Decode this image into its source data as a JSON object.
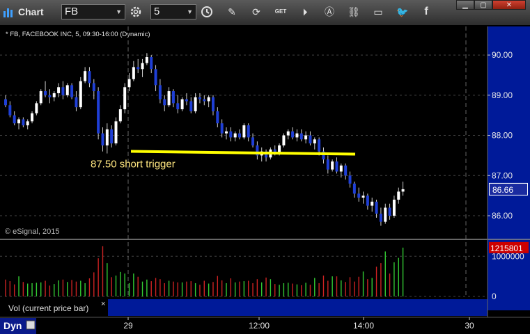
{
  "toolbar": {
    "app_title": "Chart",
    "symbol": "FB",
    "interval": "5",
    "buttons": [
      "pencil-icon",
      "refresh-icon",
      "get-icon",
      "play-icon",
      "alert-icon",
      "link-icon",
      "comment-icon",
      "twitter-icon",
      "facebook-icon"
    ],
    "window_buttons": [
      "minimize",
      "maximize",
      "close"
    ]
  },
  "chart_header": "* FB, FACEBOOK INC, 5, 09:30-16:00 (Dynamic)",
  "copyright": "© eSignal, 2015",
  "volume_label": "Vol (current price bar)",
  "volume_close": "×",
  "bottom": {
    "dyn": "Dyn"
  },
  "colors": {
    "up": "#ffffff",
    "down": "#1f3fd6",
    "panel": "#001a99",
    "price_badge": "#1a2ba0",
    "vol_badge": "#cc0000",
    "annotation": "#ffff00",
    "vol_up": "#33cc33",
    "vol_down": "#cc2222"
  },
  "chart_data": {
    "type": "candlestick",
    "y_ticks": [
      "90.00",
      "89.00",
      "88.00",
      "87.00",
      "86.00"
    ],
    "ylim": [
      85.55,
      90.4
    ],
    "x_ticks": [
      "29",
      "12:00",
      "14:00",
      "30"
    ],
    "last_price": "86.66",
    "last_volume": "1215801",
    "volume_ticks": [
      "1000000",
      "0"
    ],
    "volume_max": 1300000,
    "annotation": {
      "text": "87.50 short trigger",
      "price": 87.55
    },
    "candles": [
      [
        88.9,
        89.0,
        88.7,
        88.75
      ],
      [
        88.75,
        88.85,
        88.45,
        88.5
      ],
      [
        88.5,
        88.6,
        88.25,
        88.3
      ],
      [
        88.3,
        88.45,
        88.15,
        88.4
      ],
      [
        88.4,
        88.45,
        88.2,
        88.25
      ],
      [
        88.25,
        88.4,
        88.15,
        88.35
      ],
      [
        88.35,
        88.6,
        88.3,
        88.55
      ],
      [
        88.55,
        88.85,
        88.5,
        88.8
      ],
      [
        88.8,
        89.15,
        88.75,
        89.1
      ],
      [
        89.1,
        89.35,
        88.95,
        89.0
      ],
      [
        89.0,
        89.15,
        88.8,
        88.95
      ],
      [
        88.95,
        89.1,
        88.85,
        89.05
      ],
      [
        89.05,
        89.3,
        88.95,
        89.2
      ],
      [
        89.2,
        89.35,
        88.9,
        89.0
      ],
      [
        89.0,
        89.3,
        88.95,
        89.25
      ],
      [
        89.25,
        89.3,
        88.9,
        88.95
      ],
      [
        88.95,
        89.1,
        88.6,
        88.7
      ],
      [
        88.7,
        89.45,
        88.65,
        89.35
      ],
      [
        89.35,
        89.7,
        89.3,
        89.6
      ],
      [
        89.6,
        89.7,
        89.2,
        89.3
      ],
      [
        89.3,
        89.4,
        88.9,
        89.1
      ],
      [
        89.1,
        89.2,
        87.9,
        88.05
      ],
      [
        88.05,
        88.2,
        87.6,
        87.75
      ],
      [
        87.75,
        88.3,
        87.55,
        88.15
      ],
      [
        88.15,
        88.25,
        87.7,
        87.8
      ],
      [
        87.8,
        88.45,
        87.75,
        88.35
      ],
      [
        88.35,
        88.75,
        88.3,
        88.65
      ],
      [
        88.65,
        89.3,
        88.55,
        89.2
      ],
      [
        89.2,
        89.55,
        89.1,
        89.4
      ],
      [
        89.4,
        89.85,
        89.35,
        89.7
      ],
      [
        89.7,
        89.9,
        89.55,
        89.65
      ],
      [
        89.65,
        89.9,
        89.45,
        89.8
      ],
      [
        89.8,
        90.05,
        89.75,
        89.95
      ],
      [
        89.95,
        90.0,
        89.55,
        89.65
      ],
      [
        89.65,
        89.75,
        89.1,
        89.25
      ],
      [
        89.25,
        89.4,
        88.8,
        88.9
      ],
      [
        88.9,
        89.0,
        88.6,
        88.75
      ],
      [
        88.75,
        89.2,
        88.7,
        89.1
      ],
      [
        89.1,
        89.15,
        88.7,
        88.8
      ],
      [
        88.8,
        89.0,
        88.55,
        88.65
      ],
      [
        88.65,
        88.95,
        88.6,
        88.9
      ],
      [
        88.9,
        89.05,
        88.75,
        88.85
      ],
      [
        88.85,
        88.95,
        88.55,
        88.6
      ],
      [
        88.6,
        89.05,
        88.55,
        88.95
      ],
      [
        88.95,
        89.05,
        88.8,
        88.9
      ],
      [
        88.9,
        89.0,
        88.75,
        88.85
      ],
      [
        88.85,
        89.0,
        88.7,
        88.95
      ],
      [
        88.95,
        89.0,
        88.5,
        88.6
      ],
      [
        88.6,
        88.7,
        88.2,
        88.3
      ],
      [
        88.3,
        88.4,
        87.95,
        88.05
      ],
      [
        88.05,
        88.2,
        87.9,
        88.1
      ],
      [
        88.1,
        88.2,
        87.85,
        87.95
      ],
      [
        87.95,
        88.1,
        87.85,
        88.05
      ],
      [
        88.05,
        88.15,
        87.9,
        87.95
      ],
      [
        87.95,
        88.3,
        87.9,
        88.25
      ],
      [
        88.25,
        88.3,
        87.85,
        87.95
      ],
      [
        87.95,
        88.05,
        87.7,
        87.75
      ],
      [
        87.75,
        87.85,
        87.4,
        87.5
      ],
      [
        87.5,
        87.7,
        87.35,
        87.6
      ],
      [
        87.6,
        87.65,
        87.35,
        87.45
      ],
      [
        87.45,
        87.7,
        87.4,
        87.65
      ],
      [
        87.65,
        87.75,
        87.5,
        87.55
      ],
      [
        87.55,
        87.8,
        87.5,
        87.75
      ],
      [
        87.75,
        88.05,
        87.7,
        88.0
      ],
      [
        88.0,
        88.15,
        87.9,
        88.1
      ],
      [
        88.1,
        88.2,
        87.9,
        87.95
      ],
      [
        87.95,
        88.15,
        87.85,
        88.05
      ],
      [
        88.05,
        88.15,
        87.85,
        87.9
      ],
      [
        87.9,
        88.1,
        87.8,
        88.0
      ],
      [
        88.0,
        88.1,
        87.75,
        87.8
      ],
      [
        87.8,
        87.95,
        87.65,
        87.9
      ],
      [
        87.9,
        87.95,
        87.5,
        87.6
      ],
      [
        87.6,
        87.7,
        87.3,
        87.4
      ],
      [
        87.4,
        87.5,
        87.05,
        87.15
      ],
      [
        87.15,
        87.4,
        87.1,
        87.35
      ],
      [
        87.35,
        87.45,
        87.05,
        87.1
      ],
      [
        87.1,
        87.3,
        86.95,
        87.25
      ],
      [
        87.25,
        87.3,
        86.9,
        87.0
      ],
      [
        87.0,
        87.1,
        86.7,
        86.8
      ],
      [
        86.8,
        86.85,
        86.45,
        86.55
      ],
      [
        86.55,
        86.7,
        86.35,
        86.45
      ],
      [
        86.45,
        86.6,
        86.3,
        86.5
      ],
      [
        86.5,
        86.55,
        86.15,
        86.25
      ],
      [
        86.25,
        86.45,
        86.1,
        86.35
      ],
      [
        86.35,
        86.4,
        85.95,
        86.05
      ],
      [
        86.05,
        86.2,
        85.75,
        85.85
      ],
      [
        85.85,
        86.3,
        85.8,
        86.2
      ],
      [
        86.2,
        86.3,
        85.9,
        86.0
      ],
      [
        86.0,
        86.5,
        85.95,
        86.4
      ],
      [
        86.4,
        86.7,
        86.3,
        86.6
      ],
      [
        86.6,
        86.85,
        86.5,
        86.66
      ]
    ],
    "volumes": [
      420000,
      380000,
      300000,
      500000,
      360000,
      320000,
      330000,
      340000,
      350000,
      390000,
      270000,
      310000,
      400000,
      420000,
      360000,
      410000,
      370000,
      390000,
      330000,
      450000,
      600000,
      950000,
      1250000,
      830000,
      480000,
      520000,
      610000,
      570000,
      330000,
      570000,
      490000,
      370000,
      420000,
      380000,
      460000,
      430000,
      330000,
      390000,
      370000,
      350000,
      350000,
      370000,
      380000,
      330000,
      290000,
      390000,
      320000,
      360000,
      510000,
      400000,
      330000,
      450000,
      350000,
      370000,
      380000,
      390000,
      330000,
      430000,
      350000,
      470000,
      430000,
      310000,
      290000,
      330000,
      340000,
      320000,
      300000,
      280000,
      340000,
      290000,
      460000,
      330000,
      520000,
      390000,
      500000,
      500000,
      400000,
      360000,
      480000,
      370000,
      490000,
      620000,
      430000,
      460000,
      740000,
      830000,
      1120000,
      570000,
      850000,
      960000,
      1215801
    ]
  }
}
